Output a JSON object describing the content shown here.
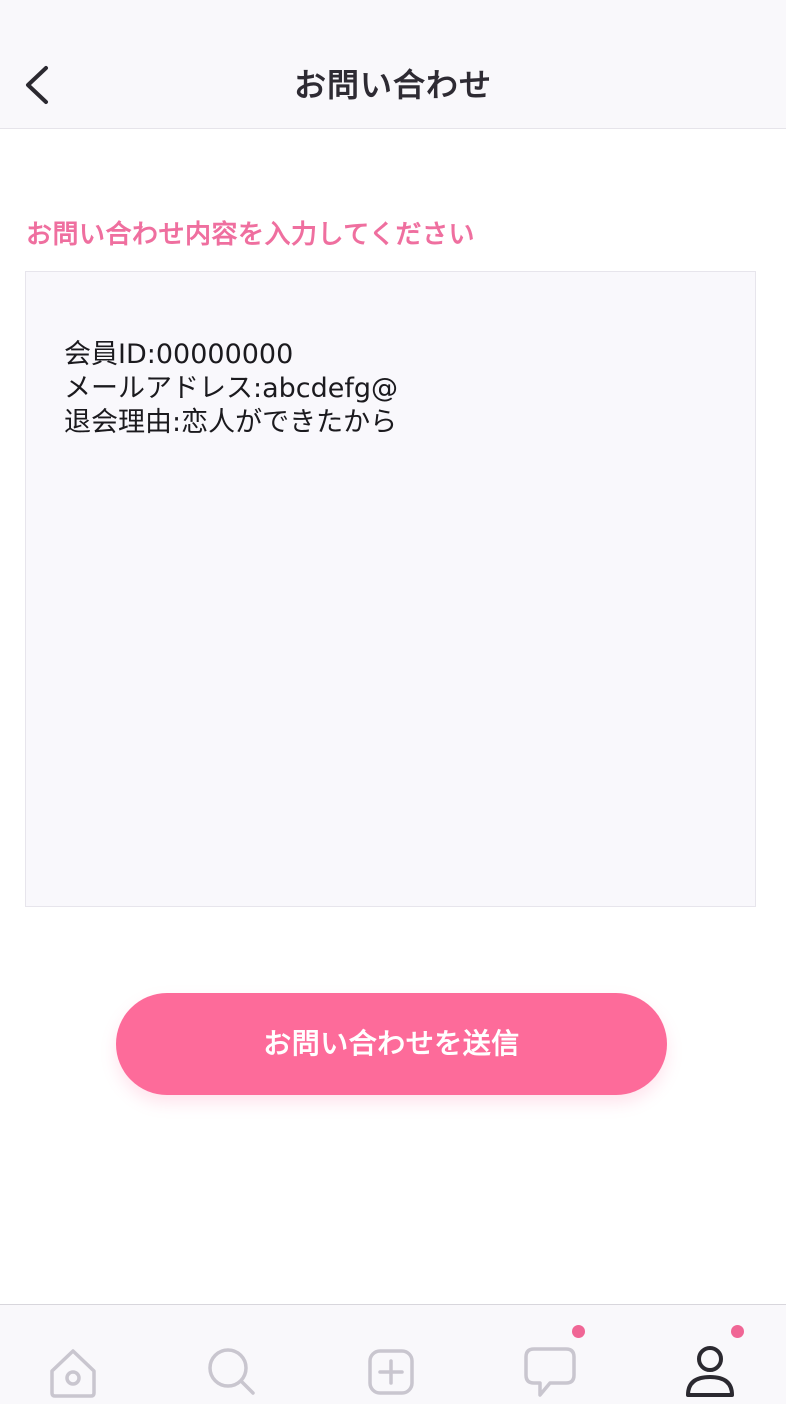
{
  "header": {
    "title": "お問い合わせ",
    "back_icon": "chevron-left-icon"
  },
  "form": {
    "label": "お問い合わせ内容を入力してください",
    "text_lines": [
      "会員ID:00000000",
      "メールアドレス:abcdefg@",
      "退会理由:恋人ができたから"
    ]
  },
  "submit": {
    "label": "お問い合わせを送信"
  },
  "tabbar": {
    "tabs": [
      {
        "icon": "home-icon",
        "badge": false
      },
      {
        "icon": "search-icon",
        "badge": false
      },
      {
        "icon": "plus-square-icon",
        "badge": false
      },
      {
        "icon": "chat-bubble-icon",
        "badge": true
      },
      {
        "icon": "profile-icon",
        "badge": true,
        "active": true
      }
    ]
  },
  "colors": {
    "accent": "#fd6b9a",
    "label_pink": "#ef6f9f",
    "badge": "#f06695",
    "inactive_icon": "#c9c6cf",
    "active_icon": "#2b2930"
  }
}
